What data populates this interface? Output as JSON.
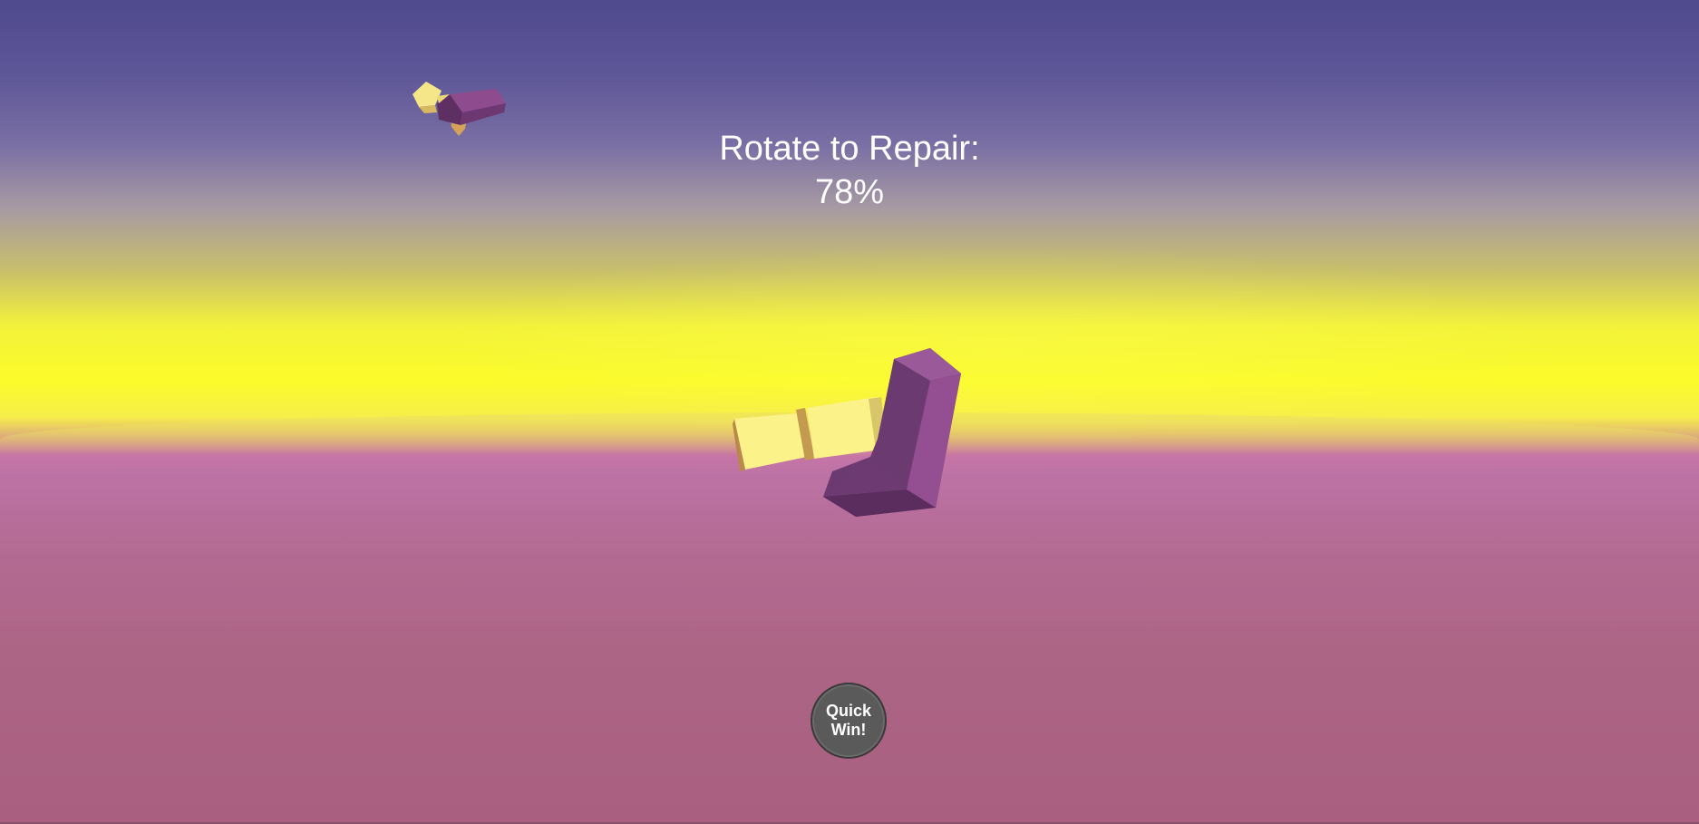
{
  "hud": {
    "title_line1": "Rotate to Repair:",
    "progress_text": "78%",
    "progress_value": 78
  },
  "quick_win_button": {
    "line1": "Quick",
    "line2": "Win!"
  },
  "colors": {
    "sky_top": "#4f4a8e",
    "horizon_yellow": "#fbfb2a",
    "ground": "#a96080",
    "block_purple": "#8c4a8c",
    "block_yellow": "#fbf38a",
    "button_gray": "#5a5a5a"
  },
  "objects": {
    "target_shape_icon": "l-shaped-purple-yellow-block",
    "broken_piece_icon": "l-shaped-purple-yellow-block-broken"
  }
}
